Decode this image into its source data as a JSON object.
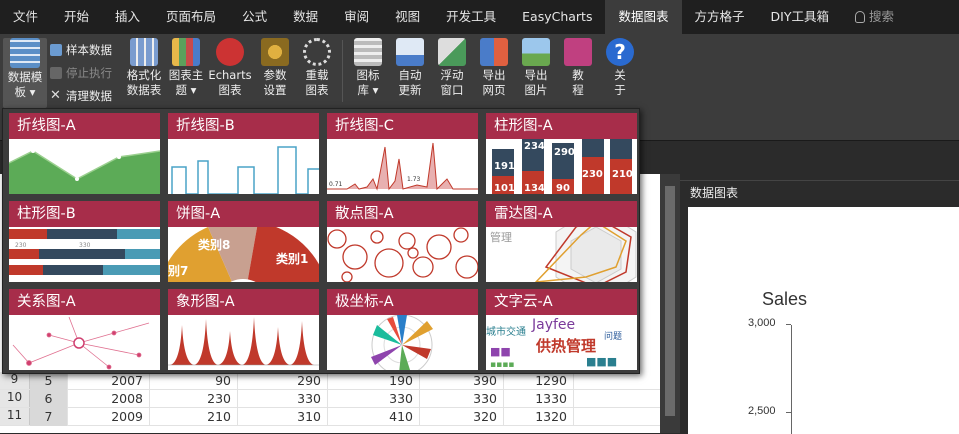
{
  "tabs": [
    "文件",
    "开始",
    "插入",
    "页面布局",
    "公式",
    "数据",
    "审阅",
    "视图",
    "开发工具",
    "EasyCharts",
    "数据图表",
    "方方格子",
    "DIY工具箱"
  ],
  "active_tab": "数据图表",
  "search_label": "搜索",
  "ribbon": {
    "data_template": {
      "line1": "数据模",
      "line2": "板 ▾"
    },
    "sample_data": "样本数据",
    "stop_exec": "停止执行",
    "clear_data": "清理数据",
    "format_table": {
      "line1": "格式化",
      "line2": "数据表"
    },
    "chart_theme": {
      "line1": "图表主",
      "line2": "题 ▾"
    },
    "echarts": {
      "line1": "Echarts",
      "line2": "图表"
    },
    "param_settings": {
      "line1": "参数",
      "line2": "设置"
    },
    "reload_chart": {
      "line1": "重载",
      "line2": "图表"
    },
    "icon_library": {
      "line1": "图标",
      "line2": "库 ▾"
    },
    "auto_update": {
      "line1": "自动",
      "line2": "更新"
    },
    "float_window": {
      "line1": "浮动",
      "line2": "窗口"
    },
    "export_web": {
      "line1": "导出",
      "line2": "网页"
    },
    "export_image": {
      "line1": "导出",
      "line2": "图片"
    },
    "tutorial": {
      "line1": "教",
      "line2": "程"
    },
    "about": {
      "line1": "关",
      "line2": "于"
    }
  },
  "gallery": [
    {
      "title": "折线图-A",
      "kind": "area"
    },
    {
      "title": "折线图-B",
      "kind": "step"
    },
    {
      "title": "折线图-C",
      "kind": "spike",
      "labels": [
        "0.71",
        "1.73"
      ]
    },
    {
      "title": "柱形图-A",
      "kind": "stack",
      "labels": [
        "191",
        "234",
        "290",
        "230",
        "210",
        "101",
        "134",
        "90"
      ]
    },
    {
      "title": "柱形图-B",
      "kind": "hbar",
      "labels": [
        "230",
        "330"
      ]
    },
    {
      "title": "饼图-A",
      "kind": "pie",
      "labels": [
        "类别8",
        "类别1",
        "别7"
      ]
    },
    {
      "title": "散点图-A",
      "kind": "bubble"
    },
    {
      "title": "雷达图-A",
      "kind": "radar",
      "labels": [
        "管理"
      ]
    },
    {
      "title": "关系图-A",
      "kind": "graph"
    },
    {
      "title": "象形图-A",
      "kind": "pictorial"
    },
    {
      "title": "极坐标-A",
      "kind": "polar"
    },
    {
      "title": "文字云-A",
      "kind": "wordcloud",
      "labels": [
        "城市交通",
        "Jayfee",
        "供热管理",
        "问题"
      ]
    }
  ],
  "sheet": {
    "rows": [
      {
        "num": "9",
        "a": "5",
        "year": "2007",
        "v1": "90",
        "v2": "290",
        "v3": "190",
        "v4": "390",
        "v5": "1290"
      },
      {
        "num": "10",
        "a": "6",
        "year": "2008",
        "v1": "230",
        "v2": "330",
        "v3": "330",
        "v4": "330",
        "v5": "1330"
      },
      {
        "num": "11",
        "a": "7",
        "year": "2009",
        "v1": "210",
        "v2": "310",
        "v3": "410",
        "v4": "320",
        "v5": "1320"
      }
    ]
  },
  "side_panel": {
    "title": "数据图表",
    "chart": {
      "title": "Sales",
      "ticks": [
        "3,000",
        "2,500"
      ]
    }
  },
  "colors": {
    "card_header": "#a72d4a",
    "accent_red": "#c0392b",
    "dark_slate": "#34495e",
    "green_fill": "#5cab57",
    "teal": "#4a9bb5"
  }
}
